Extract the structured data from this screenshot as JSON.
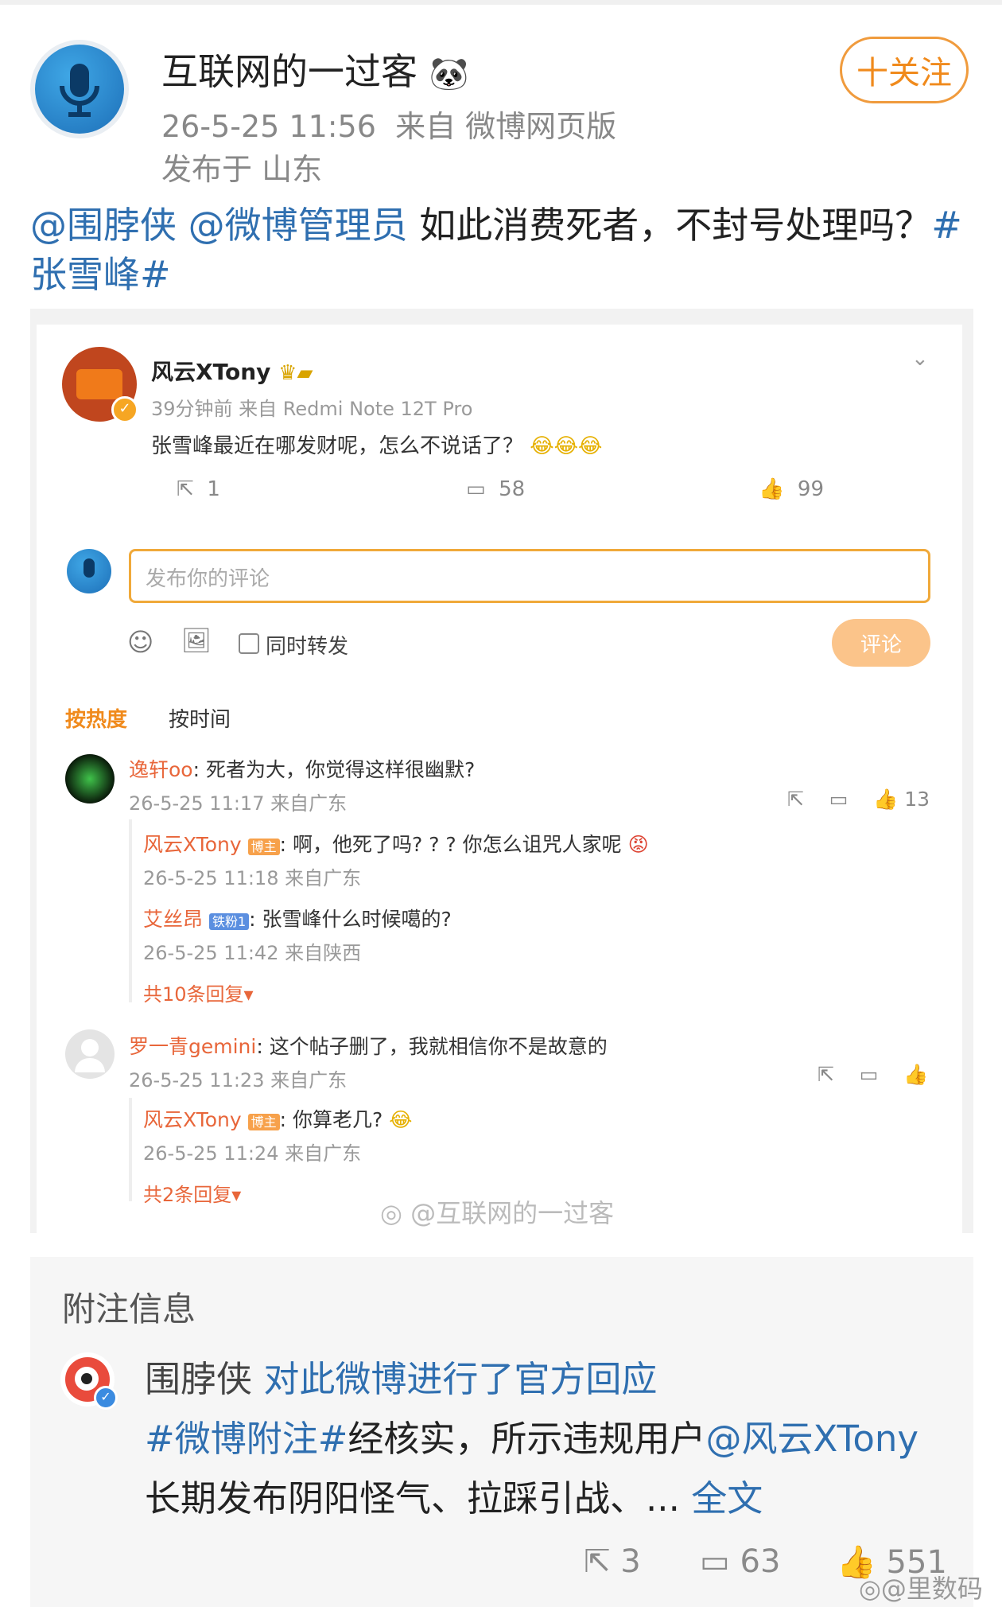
{
  "post": {
    "author": "互联网的一过客",
    "time": "26-5-25 11:56",
    "source": "来自 微博网页版",
    "location": "发布于 山东",
    "follow_label": "十关注",
    "text_mention1": "@围脖侠",
    "text_mention2": "@微博管理员",
    "text_body": " 如此消费死者，不封号处理吗？",
    "text_tag_open": "#",
    "text_tag": "张雪峰#"
  },
  "screenshot": {
    "author": "风云XTony",
    "meta": "39分钟前 来自 Redmi Note 12T Pro",
    "content": "张雪峰最近在哪发财呢，怎么不说话了？",
    "repost_count": "1",
    "comment_count": "58",
    "like_count": "99",
    "comment_placeholder": "发布你的评论",
    "also_repost": "同时转发",
    "submit_label": "评论",
    "sort_hot": "按热度",
    "sort_time": "按时间",
    "comments": [
      {
        "user": "逸轩oo",
        "text": ": 死者为大，你觉得这样很幽默?",
        "meta": "26-5-25 11:17 来自广东",
        "likes": "13",
        "replies": [
          {
            "user": "风云XTony",
            "badge": "博主",
            "text": ": 啊，他死了吗? ? ? 你怎么诅咒人家呢",
            "meta": "26-5-25 11:18 来自广东"
          },
          {
            "user": "艾丝昂",
            "badge": "铁粉1",
            "text": ": 张雪峰什么时候噶的?",
            "meta": "26-5-25 11:42 来自陕西"
          }
        ],
        "more": "共10条回复"
      },
      {
        "user": "罗一青gemini",
        "text": ": 这个帖子删了，我就相信你不是故意的",
        "meta": "26-5-25 11:23 来自广东",
        "likes": "",
        "replies": [
          {
            "user": "风云XTony",
            "badge": "博主",
            "text": ": 你算老几?",
            "meta": "26-5-25 11:24 来自广东"
          }
        ],
        "more": "共2条回复"
      }
    ],
    "watermark": "@互联网的一过客"
  },
  "annotation": {
    "title": "附注信息",
    "author": "围脖侠",
    "action": "对此微博进行了官方回应",
    "tag": "#微博附注#",
    "body1": "经核实，所示违规用户",
    "mention": "@风云XTony",
    "body2": "长期发布阴阳怪气、拉踩引战、...",
    "full_text": "全文",
    "repost": "3",
    "comment": "63",
    "like": "551",
    "watermark": "@里数码"
  },
  "colors": {
    "accent_blue": "#2f6fb0",
    "accent_orange": "#f08a1c",
    "link_orange": "#e8663a"
  }
}
